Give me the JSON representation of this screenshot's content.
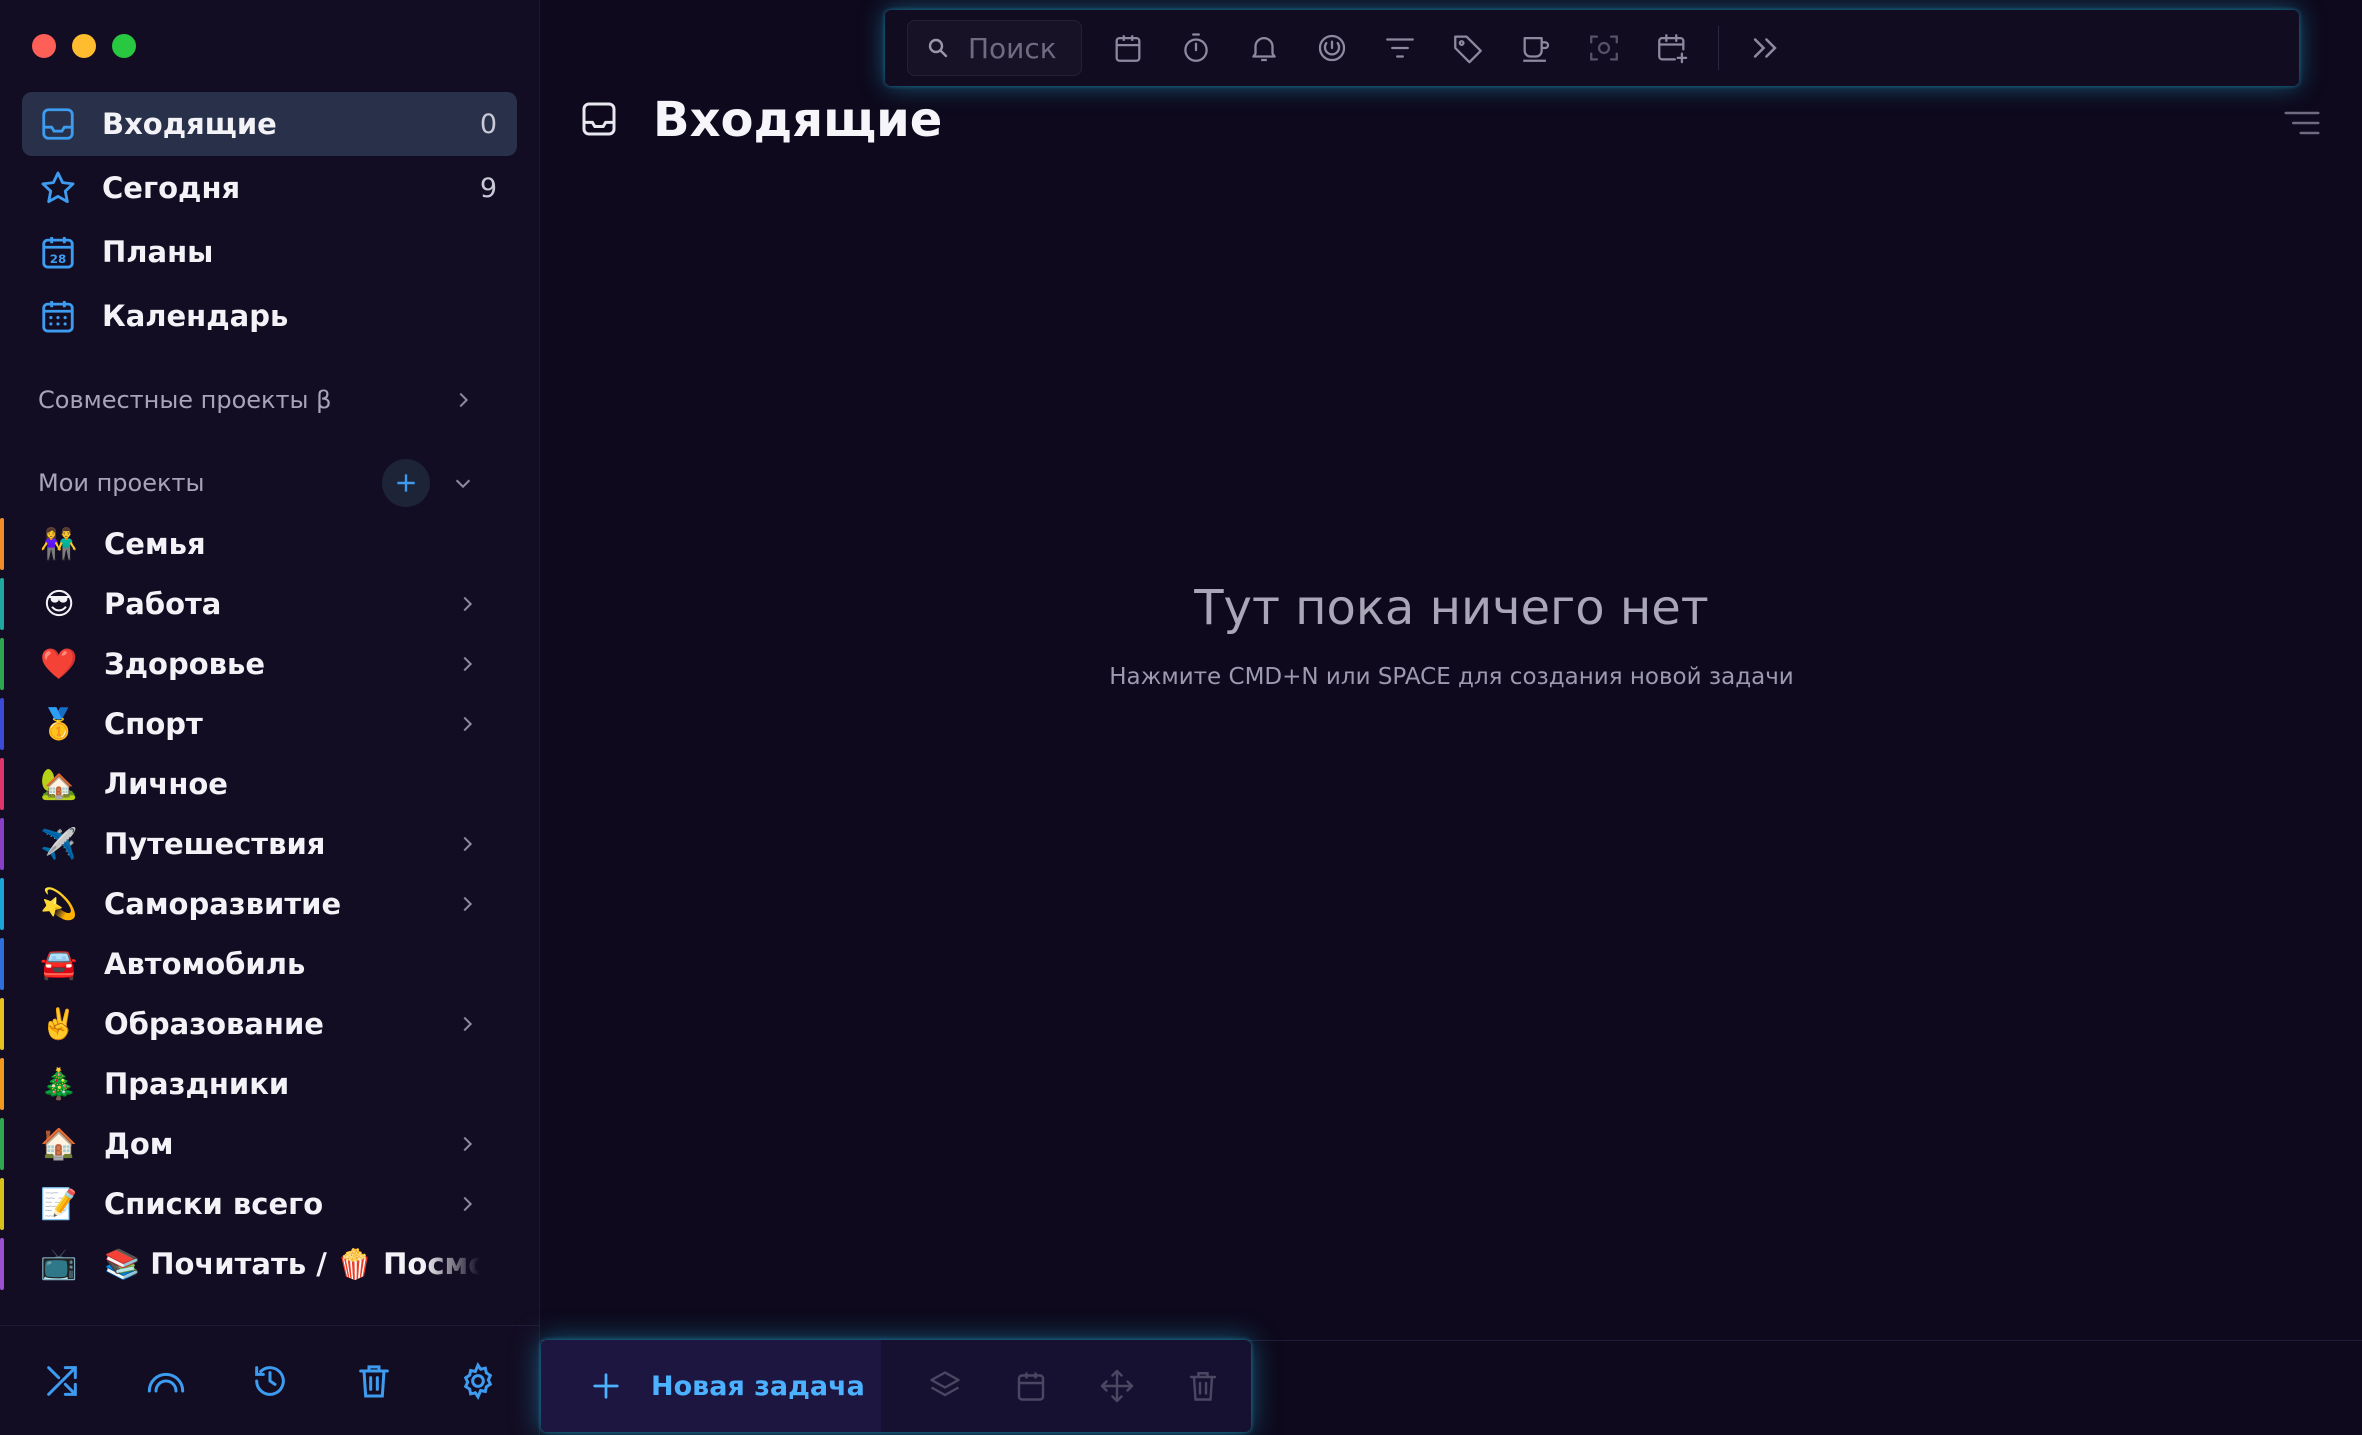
{
  "sidebar": {
    "nav": [
      {
        "label": "Входящие",
        "count": "0"
      },
      {
        "label": "Сегодня",
        "count": "9"
      },
      {
        "label": "Планы",
        "count": ""
      },
      {
        "label": "Календарь",
        "count": ""
      }
    ],
    "calendar_day": "28",
    "shared_projects_label": "Совместные проекты β",
    "my_projects_label": "Мои проекты",
    "projects": [
      {
        "emoji": "👫",
        "label": "Семья",
        "color": "#f28c28",
        "has_children": false
      },
      {
        "emoji": "😎",
        "label": "Работа",
        "color": "#1fa7a0",
        "has_children": true
      },
      {
        "emoji": "❤️",
        "label": "Здоровье",
        "color": "#2ea84f",
        "has_children": true
      },
      {
        "emoji": "🥇",
        "label": "Спорт",
        "color": "#3b4bd8",
        "has_children": true
      },
      {
        "emoji": "🏡",
        "label": "Личное",
        "color": "#e0356a",
        "has_children": false
      },
      {
        "emoji": "✈️",
        "label": "Путешествия",
        "color": "#8a3fc7",
        "has_children": true
      },
      {
        "emoji": "💫",
        "label": "Саморазвитие",
        "color": "#1aa6d8",
        "has_children": true
      },
      {
        "emoji": "🚘",
        "label": "Автомобиль",
        "color": "#2f6fdb",
        "has_children": false
      },
      {
        "emoji": "✌️",
        "label": "Образование",
        "color": "#e8c31f",
        "has_children": true
      },
      {
        "emoji": "🎄",
        "label": "Праздники",
        "color": "#f29a1f",
        "has_children": false
      },
      {
        "emoji": "🏠",
        "label": "Дом",
        "color": "#2fa84f",
        "has_children": true
      },
      {
        "emoji": "📝",
        "label": "Списки всего",
        "color": "#d8c21a",
        "has_children": true
      },
      {
        "emoji": "📺",
        "label": "📚 Почитать / 🍿 Посмотреть",
        "color": "#9c4fd0",
        "has_children": false
      }
    ]
  },
  "main": {
    "title": "Входящие",
    "search_placeholder": "Поиск",
    "empty_title": "Тут пока ничего нет",
    "empty_subtitle": "Нажмите CMD+N или SPACE для создания новой задачи",
    "new_task_label": "Новая задача"
  },
  "colors": {
    "accent": "#4cb2ff",
    "icon_blue": "#3d9cf0",
    "background": "#0f0a1e"
  },
  "icons": {
    "toolbar": [
      "calendar-icon",
      "timer-icon",
      "bell-icon",
      "focus-icon",
      "filter-icon",
      "tag-icon",
      "cup-icon",
      "screenshot-icon",
      "add-calendar-icon",
      "expand-icon"
    ],
    "bottom_tools": [
      "shuffle-icon",
      "rainbow-icon",
      "history-icon",
      "trash-icon",
      "gear-icon"
    ]
  }
}
